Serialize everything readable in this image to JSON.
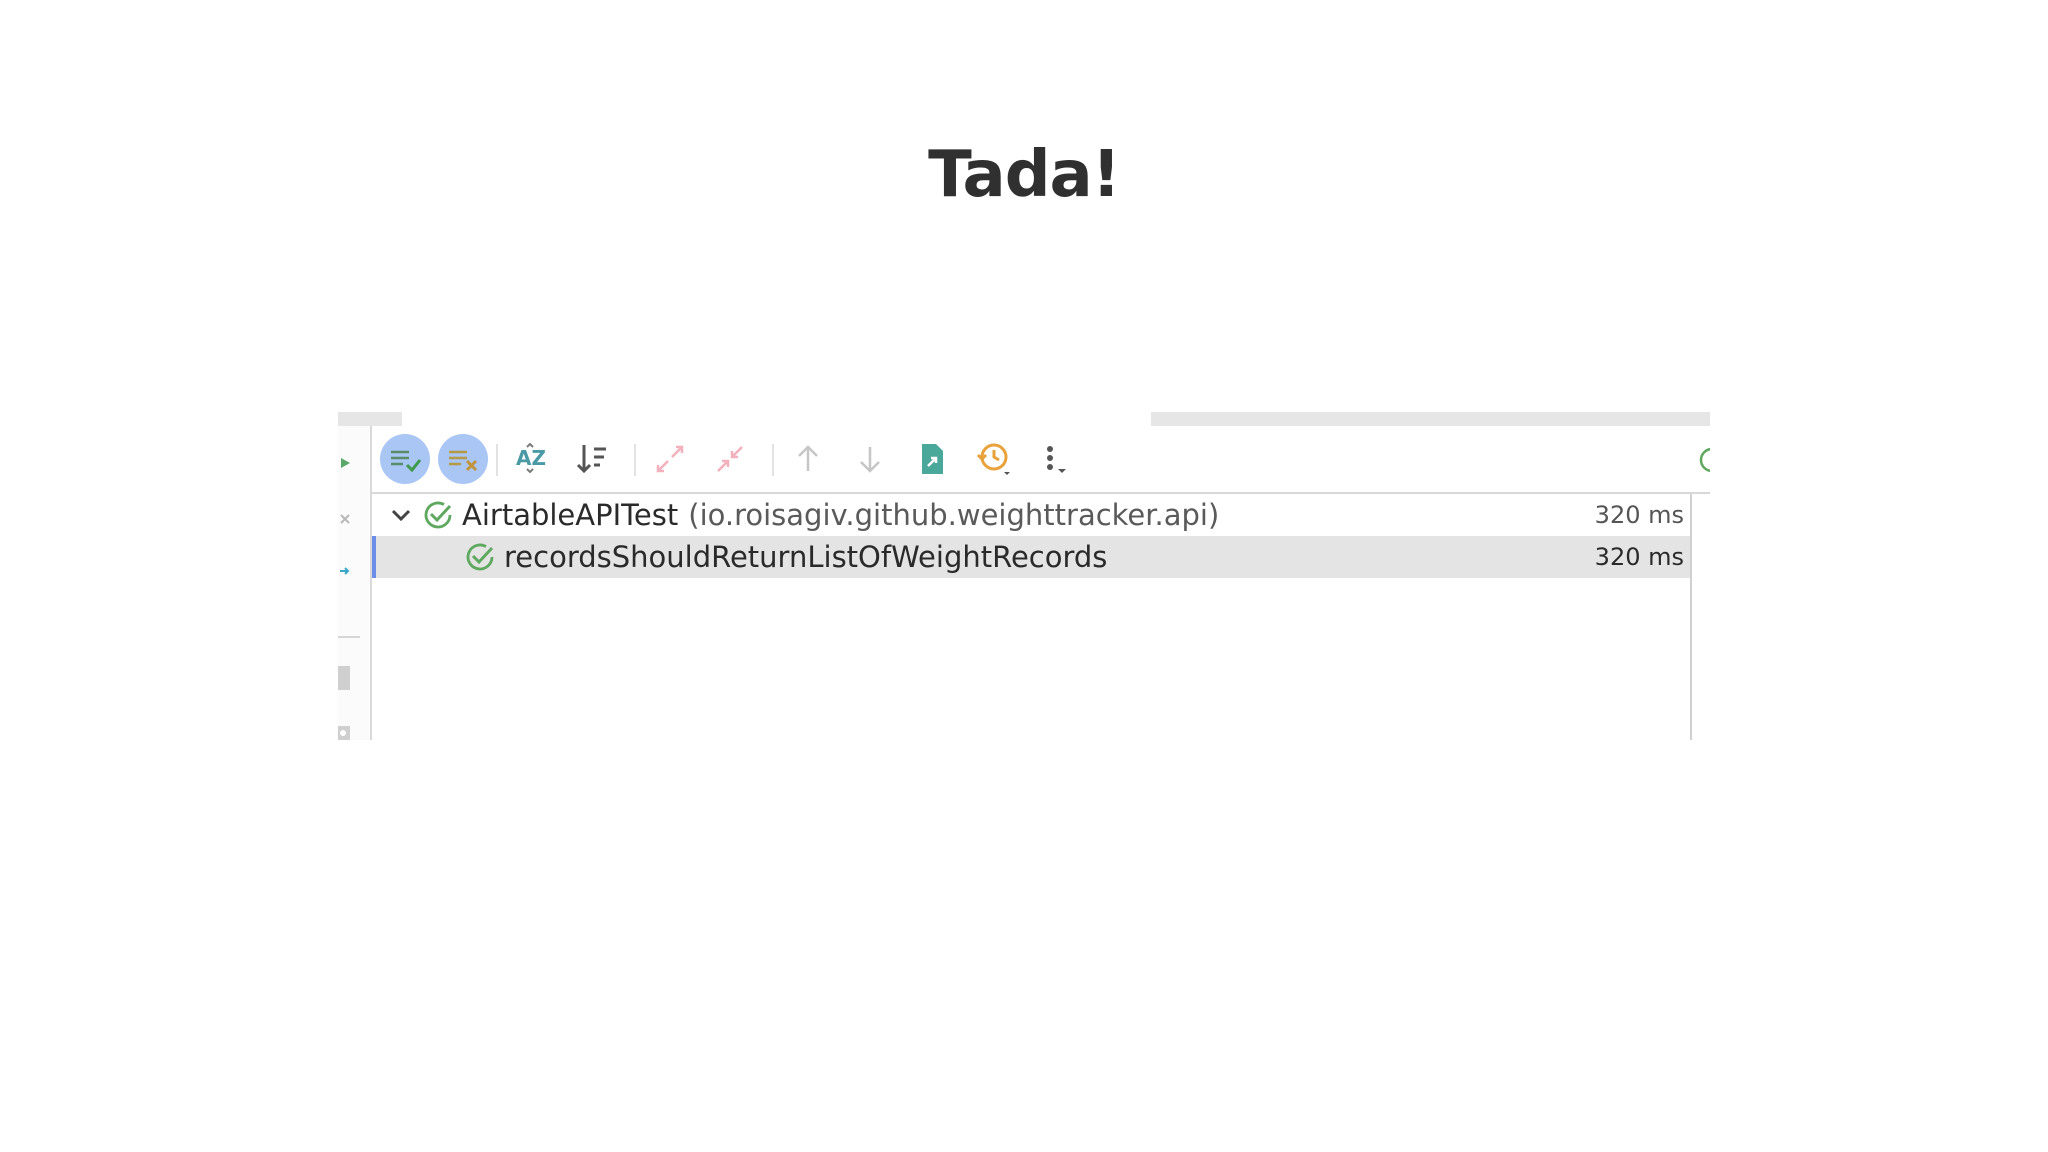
{
  "slide": {
    "title": "Tada!"
  },
  "toolbar": {
    "show_passed": "Show Passed",
    "show_ignored": "Show Ignored",
    "sort_alphabetically": "Sort Alphabetically",
    "sort_by_duration": "Sort by Duration",
    "expand_all": "Expand All",
    "collapse_all": "Collapse All",
    "previous_failed": "Previous Failed Test",
    "next_failed": "Next Failed Test",
    "export": "Export Test Results",
    "history": "Test History",
    "more": "More Options"
  },
  "tree": {
    "rows": [
      {
        "name": "AirtableAPITest",
        "package": "(io.roisagiv.github.weighttracker.api)",
        "duration": "320 ms",
        "status": "passed"
      },
      {
        "name": "recordsShouldReturnListOfWeightRecords",
        "duration": "320 ms",
        "status": "passed"
      }
    ]
  },
  "colors": {
    "passed_green": "#5fa85f",
    "toggle_blue": "#a9c6f5",
    "selection_bar": "#6b8ee8",
    "selection_bg": "#e4e4e4"
  }
}
